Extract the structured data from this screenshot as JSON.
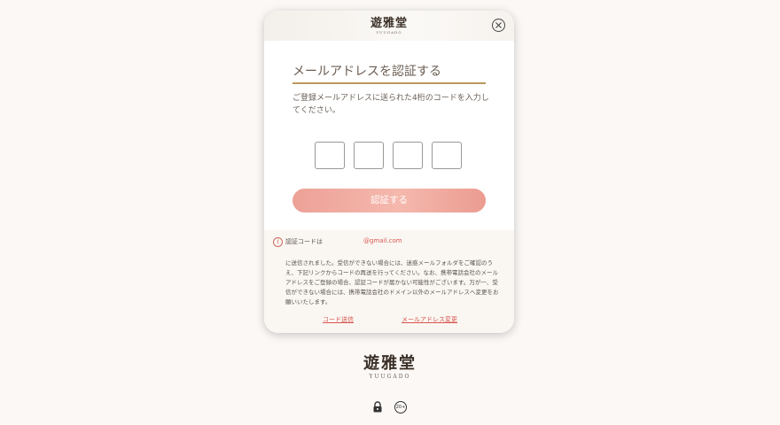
{
  "modal": {
    "logo_kanji": "遊雅堂",
    "logo_roman": "YUUGADO",
    "title": "メールアドレスを認証する",
    "description": "ご登録メールアドレスに送られた4桁のコードを入力してください。",
    "code_fields": [
      "",
      "",
      "",
      ""
    ],
    "verify_button": "認証する",
    "info": {
      "sent_label": "認証コードは",
      "email": "@gmail.com",
      "body": "に送信されました。受信ができない場合には、迷惑メールフォルダをご確認のうえ、下記リンクからコードの再送を行ってください。なお、携帯電話会社のメールアドレスをご登録の場合、認証コードが届かない可能性がございます。万が一、受信ができない場合には、携帯電話会社のドメイン以外のメールアドレスへ変更をお願いいたします。",
      "resend_link": "コード送信",
      "change_email_link": "メールアドレス変更"
    }
  },
  "footer": {
    "logo_kanji": "遊雅堂",
    "logo_roman": "YUUGADO",
    "age_badge": "20+"
  },
  "icons": {
    "close": "close-icon",
    "info": "info-icon",
    "lock": "lock-icon",
    "age": "age-restriction-icon"
  },
  "colors": {
    "accent": "#d8544c",
    "button_gradient_start": "#eda197",
    "button_gradient_end": "#eb9c91",
    "title_underline": "#b9995f"
  }
}
